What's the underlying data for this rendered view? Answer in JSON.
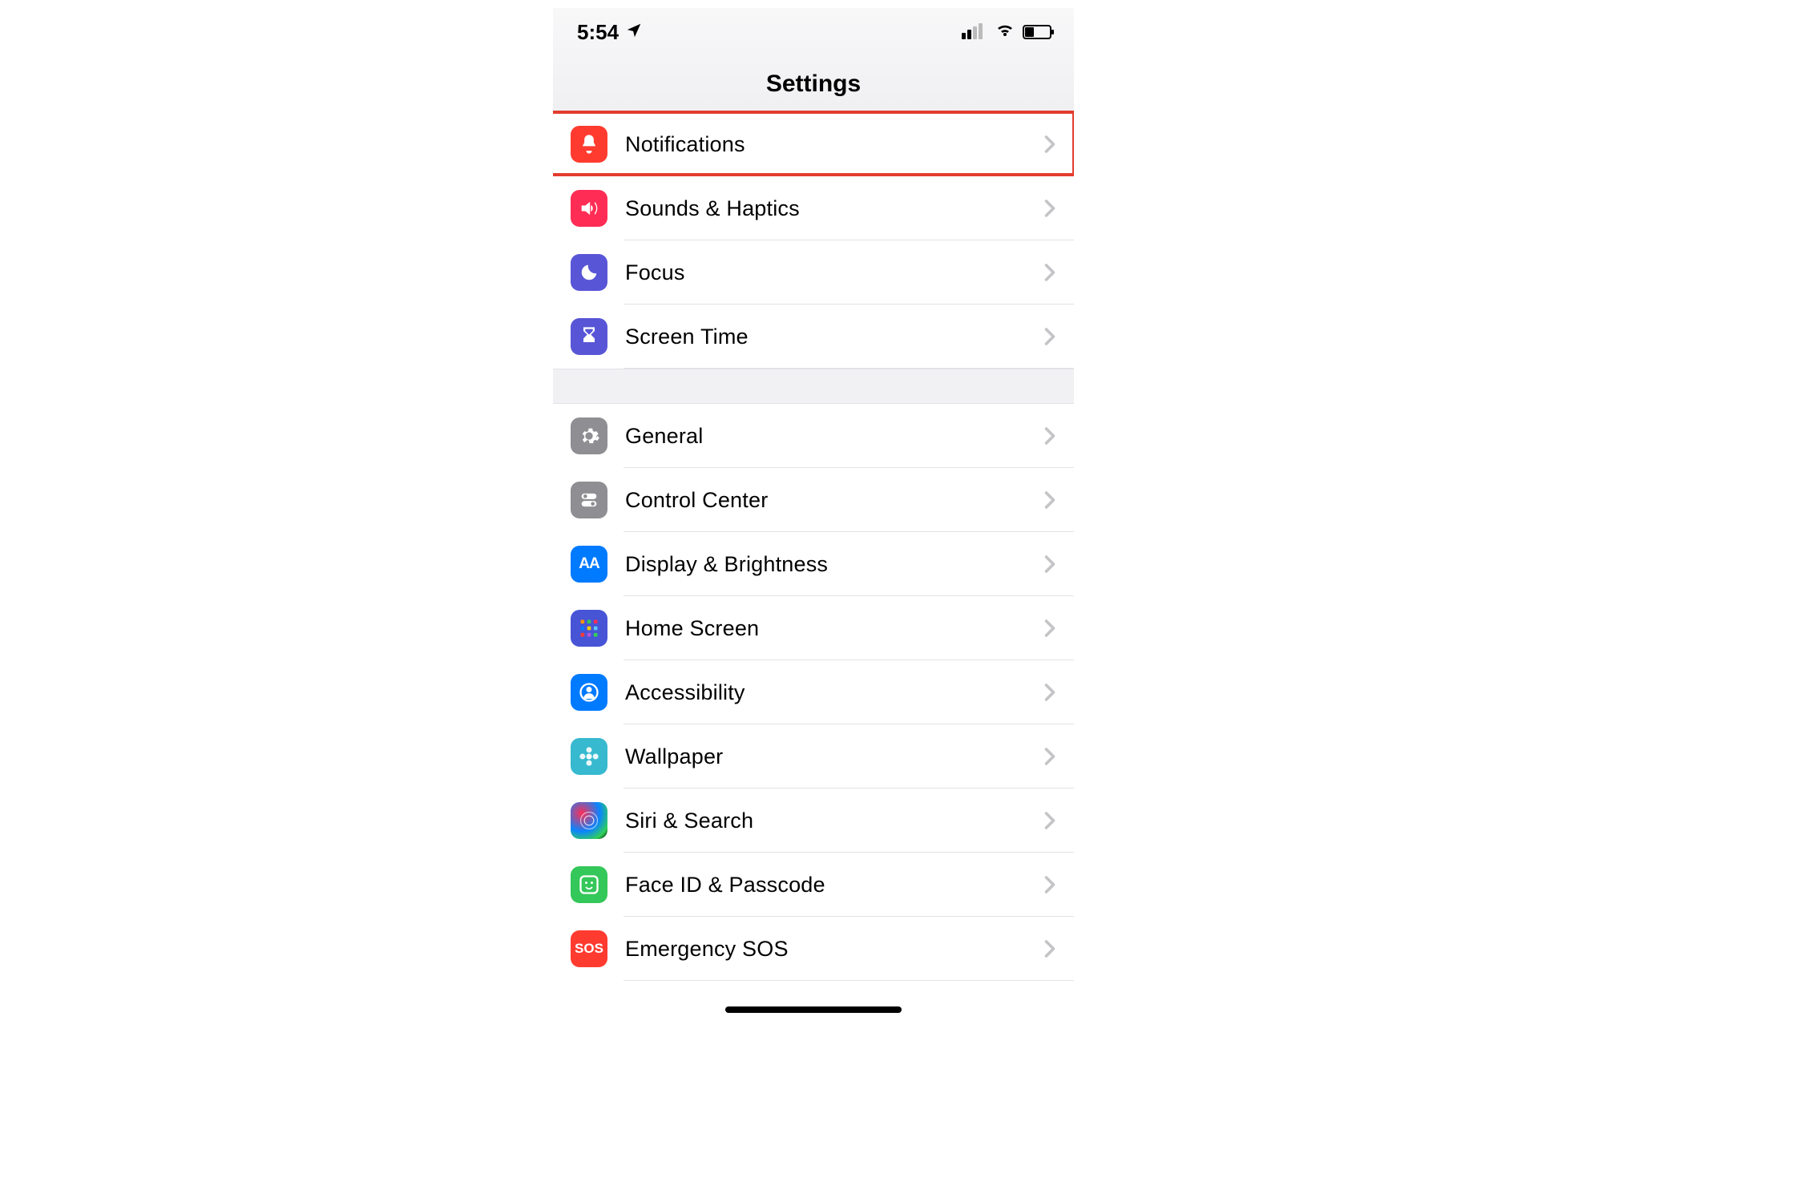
{
  "status": {
    "time": "5:54"
  },
  "navbar": {
    "title": "Settings"
  },
  "highlight_id": "notifications",
  "sections": [
    {
      "rows": [
        {
          "id": "notifications",
          "label": "Notifications",
          "icon": "bell",
          "color": "#ff3b30"
        },
        {
          "id": "sounds-haptics",
          "label": "Sounds & Haptics",
          "icon": "speaker",
          "color": "#ff2d55"
        },
        {
          "id": "focus",
          "label": "Focus",
          "icon": "moon",
          "color": "#5856d6"
        },
        {
          "id": "screen-time",
          "label": "Screen Time",
          "icon": "hourglass",
          "color": "#5856d6"
        }
      ]
    },
    {
      "rows": [
        {
          "id": "general",
          "label": "General",
          "icon": "gear",
          "color": "#8e8e93"
        },
        {
          "id": "control-center",
          "label": "Control Center",
          "icon": "switches",
          "color": "#8e8e93"
        },
        {
          "id": "display-brightness",
          "label": "Display & Brightness",
          "icon": "aa",
          "color": "#007aff"
        },
        {
          "id": "home-screen",
          "label": "Home Screen",
          "icon": "grid",
          "color": "#4754d6"
        },
        {
          "id": "accessibility",
          "label": "Accessibility",
          "icon": "person-circle",
          "color": "#007aff"
        },
        {
          "id": "wallpaper",
          "label": "Wallpaper",
          "icon": "flower",
          "color": "#37b9cf"
        },
        {
          "id": "siri-search",
          "label": "Siri & Search",
          "icon": "siri",
          "color": "siri"
        },
        {
          "id": "faceid-passcode",
          "label": "Face ID & Passcode",
          "icon": "face",
          "color": "#34c759"
        },
        {
          "id": "emergency-sos",
          "label": "Emergency SOS",
          "icon": "sos",
          "color": "#ff3b30"
        }
      ]
    }
  ]
}
